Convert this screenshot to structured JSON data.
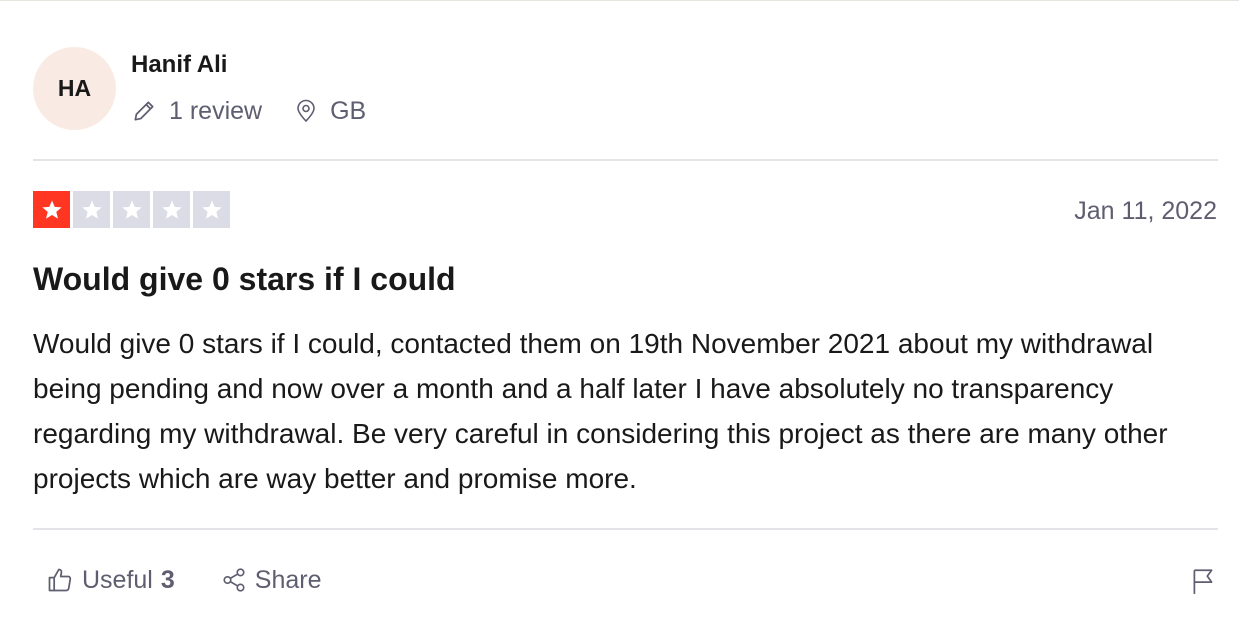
{
  "reviewer": {
    "initials": "HA",
    "name": "Hanif Ali",
    "review_count": "1 review",
    "country": "GB"
  },
  "review": {
    "rating": 1,
    "max_rating": 5,
    "date": "Jan 11, 2022",
    "title": "Would give 0 stars if I could",
    "body": "Would give 0 stars if I could, contacted them on 19th November 2021 about my withdrawal being pending and now over a month and a half later I have absolutely no transparency regarding my withdrawal. Be very careful in considering this project as there are many other projects which are way better and promise more."
  },
  "actions": {
    "useful_label": "Useful",
    "useful_count": "3",
    "share_label": "Share"
  },
  "colors": {
    "star_filled": "#ff3722",
    "star_empty": "#dcdce6",
    "avatar_bg": "#f9ebe3",
    "muted_text": "#5e5e70"
  },
  "icons": {
    "review_count": "pencil-icon",
    "country": "location-pin-icon",
    "useful": "thumbs-up-icon",
    "share": "share-icon",
    "report": "flag-icon",
    "star": "star-icon"
  }
}
